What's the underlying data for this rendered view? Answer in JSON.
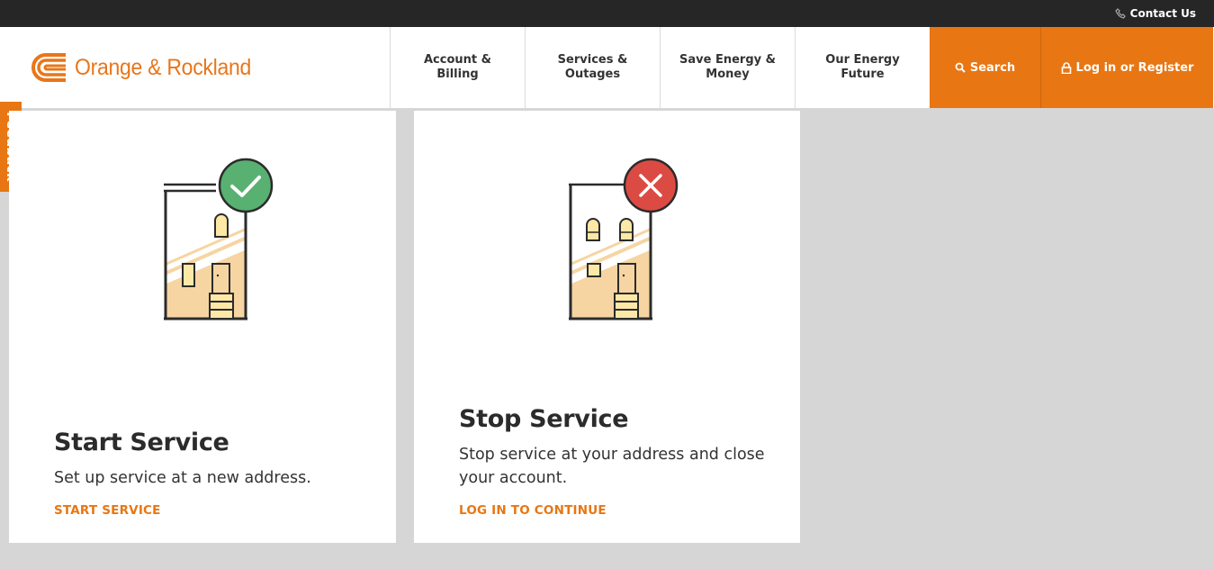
{
  "utility": {
    "contact_label": "Contact Us",
    "contact_icon": "phone-icon"
  },
  "brand": {
    "name": "Orange & Rockland",
    "color": "#e8761a"
  },
  "nav": {
    "items": [
      {
        "label": "Account & Billing"
      },
      {
        "label": "Services & Outages"
      },
      {
        "label": "Save Energy & Money"
      },
      {
        "label": "Our Energy Future"
      }
    ],
    "search_label": "Search",
    "login_label": "Log in or Register"
  },
  "feedback": {
    "label": "Feedback"
  },
  "cards": [
    {
      "title": "Start Service",
      "description": "Set up service at a new address.",
      "link": "START SERVICE",
      "status_icon": "check-icon",
      "status_color": "#58b071"
    },
    {
      "title": "Stop Service",
      "description": "Stop service at your address and close your account.",
      "link": "LOG IN TO CONTINUE",
      "status_icon": "x-icon",
      "status_color": "#dc4b43"
    }
  ],
  "colors": {
    "accent": "#e87613",
    "background": "#d6d6d6",
    "topbar": "#262626"
  }
}
